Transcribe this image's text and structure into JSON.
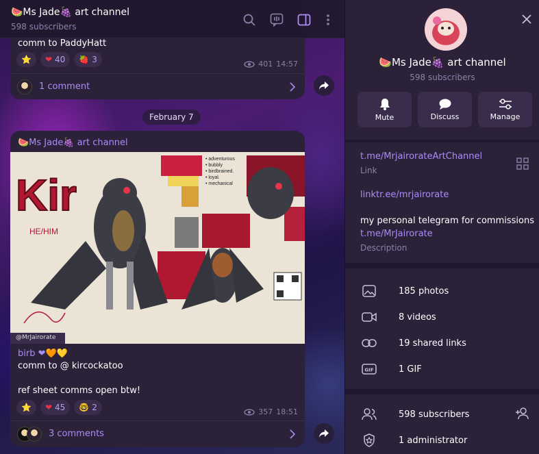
{
  "chat": {
    "title": "🍉Ms Jade🍇 art channel",
    "subtitle": "598 subscribers",
    "date_separator": "February 7",
    "prev_post": {
      "text": "comm to PaddyHatt",
      "reactions": [
        {
          "emoji": "⭐",
          "count": ""
        },
        {
          "emoji": "❤",
          "count": "40"
        },
        {
          "emoji": "🍓",
          "count": "3"
        }
      ],
      "views": "401",
      "time": "14:57",
      "comments": "1 comment"
    },
    "post": {
      "author": "🍉Ms Jade🍇 art channel",
      "artwork_signature": "@MrJairorate",
      "lines": [
        "birb ❤🧡💛",
        "comm to @ kircockatoo",
        "",
        "ref sheet comms open btw!"
      ],
      "reactions": [
        {
          "emoji": "⭐",
          "count": ""
        },
        {
          "emoji": "❤",
          "count": "45"
        },
        {
          "emoji": "🤓",
          "count": "2"
        }
      ],
      "views": "357",
      "time": "18:51",
      "comments": "3 comments"
    }
  },
  "panel": {
    "name": "🍉Ms Jade🍇 art channel",
    "subtitle": "598 subscribers",
    "actions": [
      {
        "label": "Mute",
        "icon": "bell-icon"
      },
      {
        "label": "Discuss",
        "icon": "chat-bubble-icon"
      },
      {
        "label": "Manage",
        "icon": "sliders-icon"
      }
    ],
    "link": "t.me/MrjairorateArtChannel",
    "link_caption": "Link",
    "linktree": "linktr.ee/mrjairorate",
    "description_text": "my personal telegram for commissions",
    "description_link": "t.me/MrJairorate",
    "description_caption": "Description",
    "media": [
      {
        "label": "185 photos",
        "icon": "photo-icon"
      },
      {
        "label": "8 videos",
        "icon": "video-icon"
      },
      {
        "label": "19 shared links",
        "icon": "link-icon"
      },
      {
        "label": "1 GIF",
        "icon": "gif-icon"
      }
    ],
    "members": [
      {
        "label": "598 subscribers",
        "icon": "users-icon"
      },
      {
        "label": "1 administrator",
        "icon": "admin-shield-icon"
      }
    ]
  },
  "colors": {
    "accent": "#a88df5",
    "panel_bg": "#2b2139",
    "bubble_bg": "#2b2139"
  }
}
